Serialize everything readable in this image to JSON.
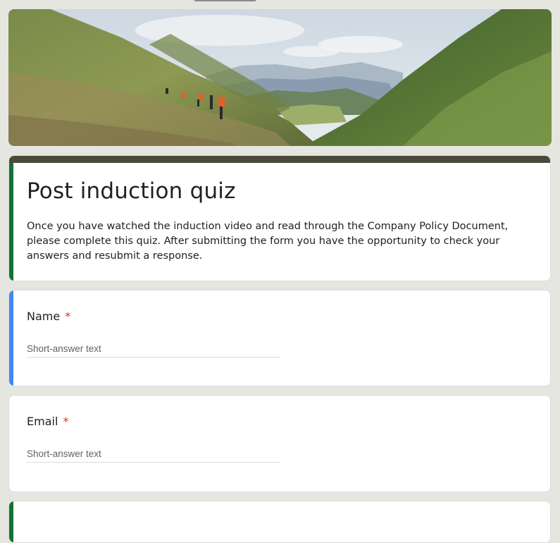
{
  "form": {
    "title": "Post induction quiz",
    "description": "Once you have watched the induction video and read through the Company Policy Document, please complete this quiz. After submitting the form you have the opportunity to check your answers and resubmit a response."
  },
  "header_image": {
    "subject": "hikers-in-mountain-valley"
  },
  "questions": [
    {
      "label": "Name",
      "required_mark": "*",
      "placeholder": "Short-answer text"
    },
    {
      "label": "Email",
      "required_mark": "*",
      "placeholder": "Short-answer text"
    }
  ],
  "colors": {
    "theme_bar": "#4a4a3c",
    "title_accent": "#137333",
    "active_accent": "#4285f4",
    "required": "#d93025",
    "background": "#e6e6e0"
  }
}
